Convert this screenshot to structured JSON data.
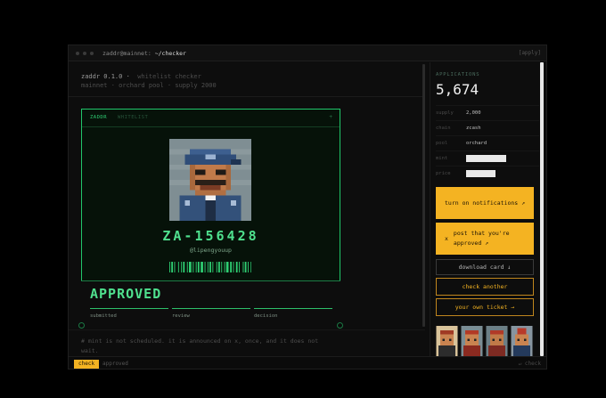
{
  "window": {
    "title_user": "zaddr@mainnet:",
    "title_path": "~/checker",
    "right_label": "[apply]"
  },
  "header": {
    "app": "zaddr 0.1.0",
    "subtitle": "whitelist checker",
    "line2": "mainnet · orchard pool · supply 2000"
  },
  "card": {
    "tag_primary": "ZADDR",
    "tag_secondary": "WHITELIST",
    "tag_right": "+",
    "id": "ZA-156428",
    "handle": "@lipengyouup"
  },
  "status": {
    "label": "APPROVED",
    "steps": [
      "submitted",
      "review",
      "decision"
    ]
  },
  "note": "# mint is not scheduled. it is announced on x, once, and it does not wait.",
  "sidebar": {
    "label": "APPLICATIONS",
    "count": "5,674",
    "rows": [
      {
        "key": "supply",
        "value": "2,000"
      },
      {
        "key": "chain",
        "value": "zcash"
      },
      {
        "key": "pool",
        "value": "orchard"
      },
      {
        "key": "mint",
        "value": ""
      },
      {
        "key": "price",
        "value": ""
      }
    ],
    "redacted_fraction": {
      "mint": 0.55,
      "price": 0.4
    },
    "notify_label": "turn on notifications ↗",
    "post_x": "x",
    "post_label": "post that you're approved ↗",
    "download_label": "download card ↓",
    "check_another_label": "check another",
    "ticket_label": "your own ticket →"
  },
  "footer": {
    "button": "check",
    "status": "approved",
    "right": "↵ check"
  },
  "colors": {
    "green": "#4fe08e",
    "amber": "#f4b322",
    "background": "#0d0d0d"
  },
  "icons": [
    "window-dots-icon",
    "x-logo-icon",
    "arrow-icon"
  ]
}
